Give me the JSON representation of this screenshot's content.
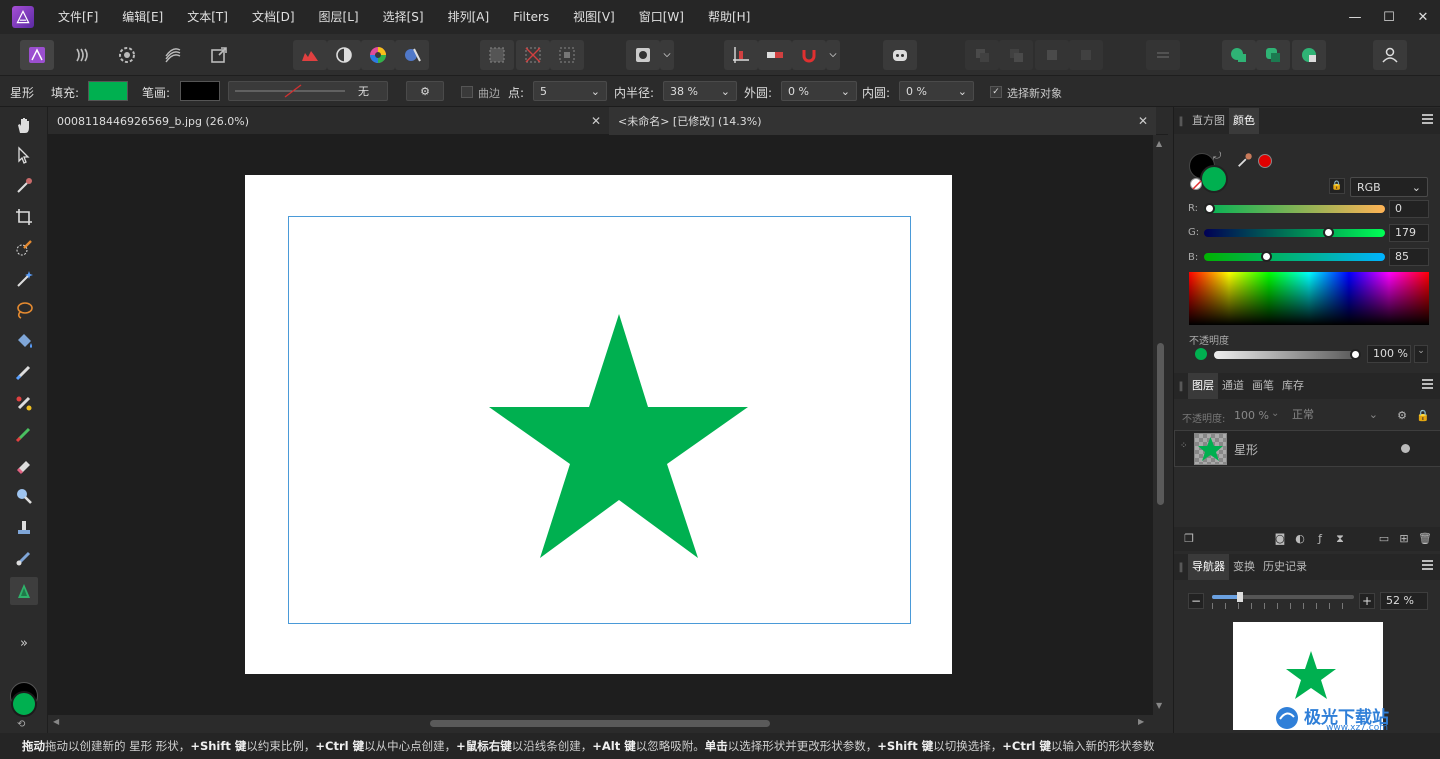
{
  "menu": [
    "文件[F]",
    "编辑[E]",
    "文本[T]",
    "文档[D]",
    "图层[L]",
    "选择[S]",
    "排列[A]",
    "Filters",
    "视图[V]",
    "窗口[W]",
    "帮助[H]"
  ],
  "window_controls": {
    "minimize": "—",
    "maximize": "☐",
    "close": "✕"
  },
  "context": {
    "tool_name": "星形",
    "fill_label": "填充:",
    "fill_color": "#00b050",
    "stroke_label": "笔画:",
    "stroke_color": "#000000",
    "stroke_value": "无",
    "curve_label": "曲边",
    "points_label": "点:",
    "points_value": "5",
    "inner_radius_label": "内半径:",
    "inner_radius_value": "38 %",
    "outer_circle_label": "外圆:",
    "outer_circle_value": "0 %",
    "inner_circle_label": "内圆:",
    "inner_circle_value": "0 %",
    "select_new_label": "选择新对象"
  },
  "doc_tabs": [
    {
      "title": "0008118446926569_b.jpg (26.0%)",
      "close": "✕"
    },
    {
      "title": "<未命名> [已修改] (14.3%)",
      "close": "✕"
    }
  ],
  "canvas": {
    "star_color": "#00b050",
    "selection_color": "#4a9ad8"
  },
  "tools_more": "»",
  "color_panel": {
    "tabs": [
      "直方图",
      "颜色"
    ],
    "mode": "RGB",
    "r_label": "R:",
    "r_value": "0",
    "g_label": "G:",
    "g_value": "179",
    "b_label": "B:",
    "b_value": "85",
    "r_fraction": 0.0,
    "g_fraction": 0.702,
    "b_fraction": 0.333,
    "opacity_label": "不透明度",
    "opacity_value": "100 %",
    "primary_color": "#00b050",
    "secondary_color": "#000000"
  },
  "layers_panel": {
    "tabs": [
      "图层",
      "通道",
      "画笔",
      "库存"
    ],
    "opacity_label": "不透明度:",
    "opacity_value": "100 %",
    "blend_mode": "正常",
    "layer_name": "星形"
  },
  "navigator_panel": {
    "tabs": [
      "导航器",
      "变换",
      "历史记录"
    ],
    "zoom_minus": "−",
    "zoom_plus": "+",
    "zoom_value": "52 %",
    "zoom_fraction": 0.2
  },
  "watermark": {
    "text": "极光下载站",
    "url": "www.xz7.com"
  },
  "status": [
    {
      "b": "拖动",
      "t": " 拖动以创建新的 星形 形状，"
    },
    {
      "b": "+Shift 键",
      "t": " 以约束比例，"
    },
    {
      "b": "+Ctrl 键",
      "t": " 以从中心点创建，"
    },
    {
      "b": "+鼠标右键",
      "t": " 以沿线条创建，"
    },
    {
      "b": "+Alt 键",
      "t": " 以忽略吸附。"
    },
    {
      "b": "单击",
      "t": " 以选择形状并更改形状参数，"
    },
    {
      "b": "+Shift 键",
      "t": " 以切换选择，"
    },
    {
      "b": "+Ctrl 键",
      "t": " 以输入新的形状参数"
    }
  ]
}
